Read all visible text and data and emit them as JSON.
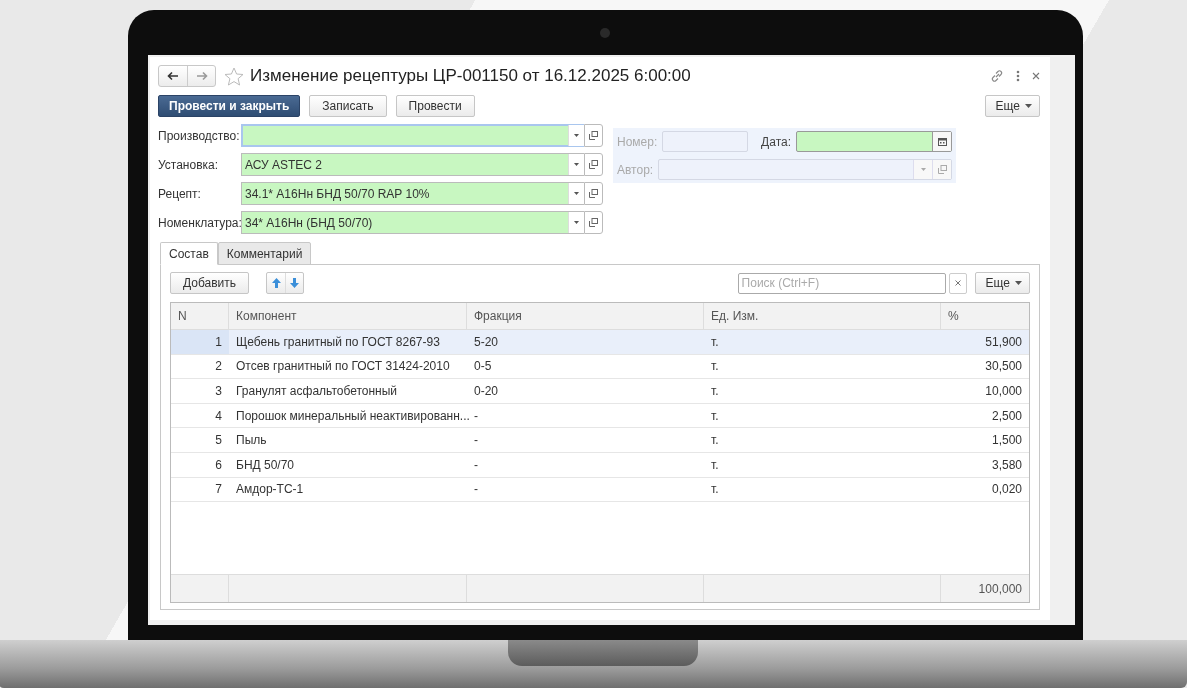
{
  "window": {
    "title": "Изменение рецептуры ЦР-001150 от 16.12.2025 6:00:00",
    "favorite": false
  },
  "toolbar": {
    "buttons": [
      {
        "label": "Провести и закрыть",
        "kind": "primary"
      },
      {
        "label": "Записать",
        "kind": "normal"
      },
      {
        "label": "Провести",
        "kind": "normal"
      }
    ],
    "more": "Еще"
  },
  "fields": [
    {
      "label": "Производство:",
      "focused": true
    },
    {
      "label": "Установка:",
      "value": "АСУ ASTEC 2",
      "focused": false
    },
    {
      "label": "Рецепт:",
      "value": "34.1* А16Нн БНД 50/70 RAP 10%",
      "focused": false
    },
    {
      "label": "Номенклатура:",
      "value": "34* А16Нн (БНД 50/70)",
      "focused": false
    }
  ],
  "side_fields": [
    {
      "label": "Номер:",
      "kind": "text",
      "disabled": true
    },
    {
      "label": "Дата:",
      "kind": "date",
      "disabled": false
    },
    {
      "label": "Автор:",
      "kind": "select",
      "disabled": true
    }
  ],
  "tabs": [
    {
      "label": "Состав",
      "selected": true
    },
    {
      "label": "Комментарий",
      "selected": false
    }
  ],
  "table_toolbar": {
    "add": "Добавить",
    "search": {
      "placeholder": "Поиск (Ctrl+F)"
    },
    "more": "Еще"
  },
  "table": {
    "columns": [
      "N",
      "Компонент",
      "Фракция",
      "Ед. Изм.",
      "%"
    ],
    "rows": [
      {
        "cells": [
          "1",
          "Щебень гранитный по ГОСТ 8267-93",
          "5-20",
          "т.",
          "51,900"
        ],
        "selected": true
      },
      {
        "cells": [
          "2",
          "Отсев гранитный по ГОСТ 31424-2010",
          "0-5",
          "т.",
          "30,500"
        ],
        "selected": false
      },
      {
        "cells": [
          "3",
          "Гранулят асфальтобетонный",
          "0-20",
          "т.",
          "10,000"
        ],
        "selected": false
      },
      {
        "cells": [
          "4",
          "Порошок минеральный неактивированн...",
          "-",
          "т.",
          "2,500"
        ],
        "selected": false
      },
      {
        "cells": [
          "5",
          "Пыль",
          "-",
          "т.",
          "1,500"
        ],
        "selected": false
      },
      {
        "cells": [
          "6",
          "БНД 50/70",
          "-",
          "т.",
          "3,580"
        ],
        "selected": false
      },
      {
        "cells": [
          "7",
          "Амдор-ТС-1",
          "-",
          "т.",
          "0,020"
        ],
        "selected": false
      }
    ],
    "total": "100,000"
  }
}
